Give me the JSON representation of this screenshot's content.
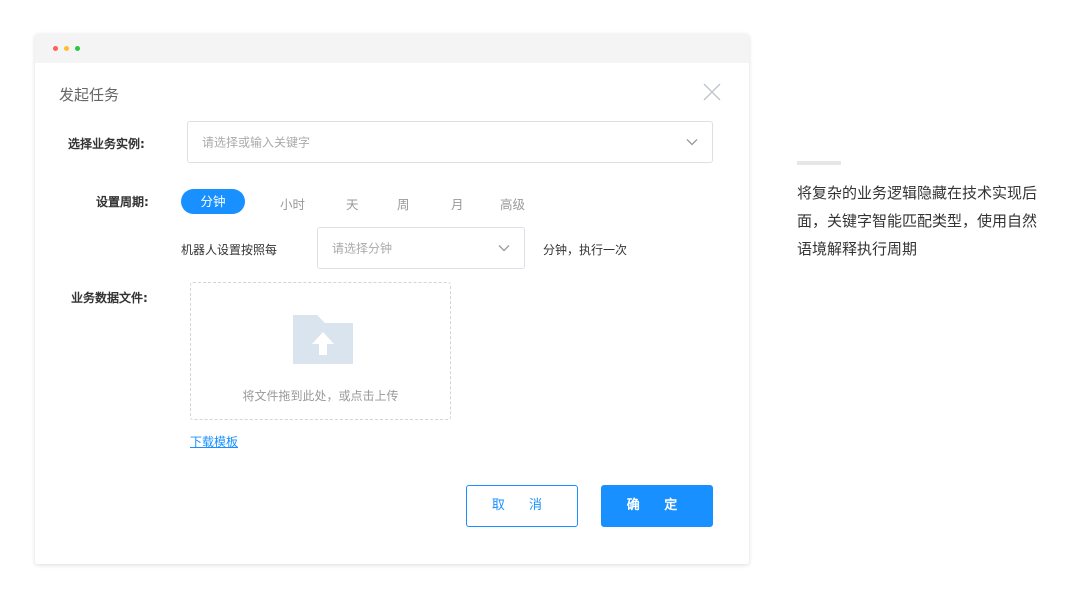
{
  "window": {
    "traffic_lights": [
      "#ff5f57",
      "#ffbd2e",
      "#28c840"
    ]
  },
  "dialog": {
    "title": "发起任务",
    "instance_label": "选择业务实例:",
    "instance_placeholder": "请选择或输入关键字",
    "period_label": "设置周期:",
    "period_tabs": [
      "分钟",
      "小时",
      "天",
      "周",
      "月",
      "高级"
    ],
    "period_active": "分钟",
    "robot_prefix": "机器人设置按照每",
    "minute_placeholder": "请选择分钟",
    "robot_suffix": "分钟，执行一次",
    "file_label": "业务数据文件:",
    "upload_text": "将文件拖到此处，或点击上传",
    "download_link": "下载模板",
    "cancel_label": "取 消",
    "ok_label": "确 定"
  },
  "side_note": {
    "text": "将复杂的业务逻辑隐藏在技术实现后面，关键字智能匹配类型，使用自然语境解释执行周期"
  },
  "colors": {
    "accent": "#1890ff",
    "folder": "#d9e4ef"
  },
  "icons": {
    "close": "close-icon",
    "chevron": "chevron-down-icon",
    "upload": "folder-upload-icon"
  }
}
